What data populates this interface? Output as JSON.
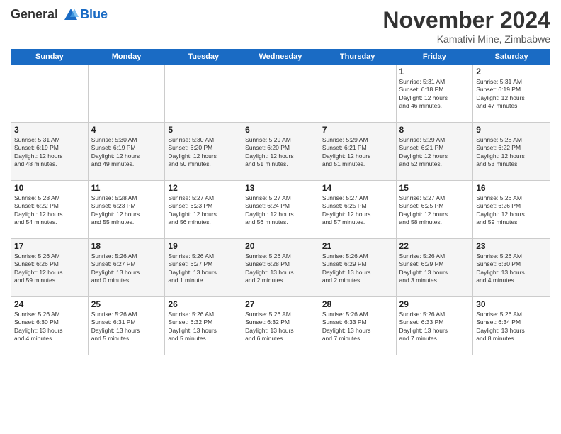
{
  "logo": {
    "line1": "General",
    "line2": "Blue"
  },
  "title": "November 2024",
  "location": "Kamativi Mine, Zimbabwe",
  "days_header": [
    "Sunday",
    "Monday",
    "Tuesday",
    "Wednesday",
    "Thursday",
    "Friday",
    "Saturday"
  ],
  "weeks": [
    [
      {
        "day": "",
        "info": ""
      },
      {
        "day": "",
        "info": ""
      },
      {
        "day": "",
        "info": ""
      },
      {
        "day": "",
        "info": ""
      },
      {
        "day": "",
        "info": ""
      },
      {
        "day": "1",
        "info": "Sunrise: 5:31 AM\nSunset: 6:18 PM\nDaylight: 12 hours\nand 46 minutes."
      },
      {
        "day": "2",
        "info": "Sunrise: 5:31 AM\nSunset: 6:19 PM\nDaylight: 12 hours\nand 47 minutes."
      }
    ],
    [
      {
        "day": "3",
        "info": "Sunrise: 5:31 AM\nSunset: 6:19 PM\nDaylight: 12 hours\nand 48 minutes."
      },
      {
        "day": "4",
        "info": "Sunrise: 5:30 AM\nSunset: 6:19 PM\nDaylight: 12 hours\nand 49 minutes."
      },
      {
        "day": "5",
        "info": "Sunrise: 5:30 AM\nSunset: 6:20 PM\nDaylight: 12 hours\nand 50 minutes."
      },
      {
        "day": "6",
        "info": "Sunrise: 5:29 AM\nSunset: 6:20 PM\nDaylight: 12 hours\nand 51 minutes."
      },
      {
        "day": "7",
        "info": "Sunrise: 5:29 AM\nSunset: 6:21 PM\nDaylight: 12 hours\nand 51 minutes."
      },
      {
        "day": "8",
        "info": "Sunrise: 5:29 AM\nSunset: 6:21 PM\nDaylight: 12 hours\nand 52 minutes."
      },
      {
        "day": "9",
        "info": "Sunrise: 5:28 AM\nSunset: 6:22 PM\nDaylight: 12 hours\nand 53 minutes."
      }
    ],
    [
      {
        "day": "10",
        "info": "Sunrise: 5:28 AM\nSunset: 6:22 PM\nDaylight: 12 hours\nand 54 minutes."
      },
      {
        "day": "11",
        "info": "Sunrise: 5:28 AM\nSunset: 6:23 PM\nDaylight: 12 hours\nand 55 minutes."
      },
      {
        "day": "12",
        "info": "Sunrise: 5:27 AM\nSunset: 6:23 PM\nDaylight: 12 hours\nand 56 minutes."
      },
      {
        "day": "13",
        "info": "Sunrise: 5:27 AM\nSunset: 6:24 PM\nDaylight: 12 hours\nand 56 minutes."
      },
      {
        "day": "14",
        "info": "Sunrise: 5:27 AM\nSunset: 6:25 PM\nDaylight: 12 hours\nand 57 minutes."
      },
      {
        "day": "15",
        "info": "Sunrise: 5:27 AM\nSunset: 6:25 PM\nDaylight: 12 hours\nand 58 minutes."
      },
      {
        "day": "16",
        "info": "Sunrise: 5:26 AM\nSunset: 6:26 PM\nDaylight: 12 hours\nand 59 minutes."
      }
    ],
    [
      {
        "day": "17",
        "info": "Sunrise: 5:26 AM\nSunset: 6:26 PM\nDaylight: 12 hours\nand 59 minutes."
      },
      {
        "day": "18",
        "info": "Sunrise: 5:26 AM\nSunset: 6:27 PM\nDaylight: 13 hours\nand 0 minutes."
      },
      {
        "day": "19",
        "info": "Sunrise: 5:26 AM\nSunset: 6:27 PM\nDaylight: 13 hours\nand 1 minute."
      },
      {
        "day": "20",
        "info": "Sunrise: 5:26 AM\nSunset: 6:28 PM\nDaylight: 13 hours\nand 2 minutes."
      },
      {
        "day": "21",
        "info": "Sunrise: 5:26 AM\nSunset: 6:29 PM\nDaylight: 13 hours\nand 2 minutes."
      },
      {
        "day": "22",
        "info": "Sunrise: 5:26 AM\nSunset: 6:29 PM\nDaylight: 13 hours\nand 3 minutes."
      },
      {
        "day": "23",
        "info": "Sunrise: 5:26 AM\nSunset: 6:30 PM\nDaylight: 13 hours\nand 4 minutes."
      }
    ],
    [
      {
        "day": "24",
        "info": "Sunrise: 5:26 AM\nSunset: 6:30 PM\nDaylight: 13 hours\nand 4 minutes."
      },
      {
        "day": "25",
        "info": "Sunrise: 5:26 AM\nSunset: 6:31 PM\nDaylight: 13 hours\nand 5 minutes."
      },
      {
        "day": "26",
        "info": "Sunrise: 5:26 AM\nSunset: 6:32 PM\nDaylight: 13 hours\nand 5 minutes."
      },
      {
        "day": "27",
        "info": "Sunrise: 5:26 AM\nSunset: 6:32 PM\nDaylight: 13 hours\nand 6 minutes."
      },
      {
        "day": "28",
        "info": "Sunrise: 5:26 AM\nSunset: 6:33 PM\nDaylight: 13 hours\nand 7 minutes."
      },
      {
        "day": "29",
        "info": "Sunrise: 5:26 AM\nSunset: 6:33 PM\nDaylight: 13 hours\nand 7 minutes."
      },
      {
        "day": "30",
        "info": "Sunrise: 5:26 AM\nSunset: 6:34 PM\nDaylight: 13 hours\nand 8 minutes."
      }
    ]
  ]
}
